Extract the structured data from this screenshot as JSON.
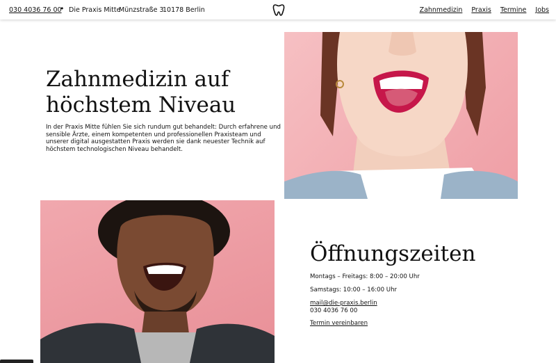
{
  "header": {
    "phone": "030 4036 76 00",
    "separator": "•",
    "practice_name": "Die Praxis Mitte",
    "street": "Münzstraße 3",
    "city": "10178 Berlin",
    "logo_icon": "tooth-icon",
    "nav": [
      "Zahnmedizin",
      "Praxis",
      "Termine",
      "Jobs"
    ]
  },
  "hero": {
    "title_line1": "Zahnmedizin auf",
    "title_line2": "höchstem Niveau",
    "text": "In der Praxis Mitte fühlen Sie sich rundum gut behandelt: Durch erfahrene und sensible Ärzte, einem kompetenten und professionellen Praxisteam und unserer digital ausgestatten Praxis werden sie dank neuester Technik auf höchstem technologischen Niveau behandelt."
  },
  "hours": {
    "title": "Öffnungszeiten",
    "weekdays": "Montags – Freitags: 8:00 – 20:00 Uhr",
    "saturday": "Samstags: 10:00 – 16:00 Uhr",
    "email": "mail@die-praxis.berlin",
    "phone": "030 4036 76 00",
    "appointment_link": "Termin vereinbaren"
  },
  "colors": {
    "accent_pink": "#f1a8ae",
    "text": "#111111"
  }
}
